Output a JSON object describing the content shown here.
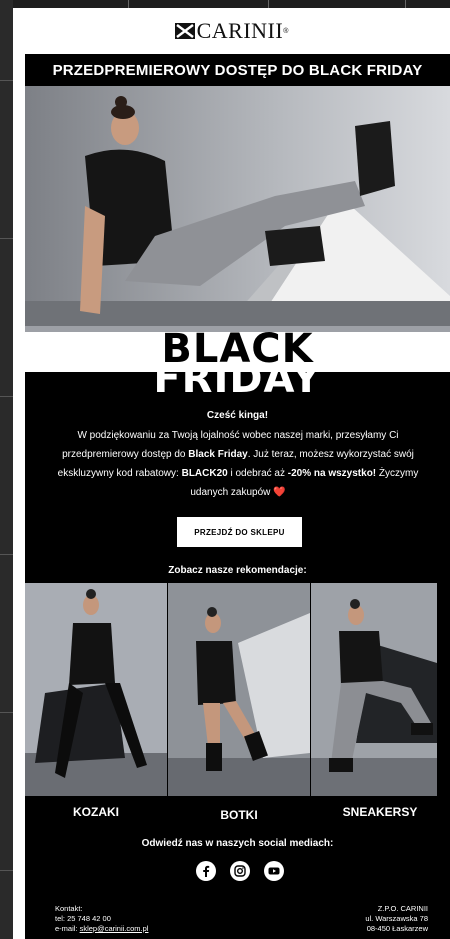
{
  "brand": {
    "name": "CARINII",
    "trademark": "®"
  },
  "promo_banner": "PRZEDPREMIEROWY DOSTĘP DO BLACK FRIDAY",
  "headline": {
    "line1": "BLACK",
    "line2": "FRIDAY"
  },
  "greeting": "Cześć kinga!",
  "message": {
    "part1": "W podziękowaniu za Twoją lojalność wobec naszej marki, przesyłamy Ci przedpremierowy dostęp do ",
    "bold1": "Black Friday",
    "part2": ". Już teraz, możesz wykorzystać swój ekskluzywny kod rabatowy: ",
    "code": "BLACK20",
    "part3": " i odebrać aż ",
    "bold2": "-20% na wszystko!",
    "part4": " Życzymy udanych zakupów ",
    "heart": "❤️"
  },
  "cta_label": "PRZEJDŹ DO SKLEPU",
  "recommendations_title": "Zobacz nasze rekomendacje:",
  "products": [
    {
      "label": "KOZAKI"
    },
    {
      "label": "BOTKI"
    },
    {
      "label": "SNEAKERSY"
    }
  ],
  "social_title": "Odwiedź nas w naszych social mediach:",
  "social_icons": [
    "facebook-icon",
    "instagram-icon",
    "youtube-icon"
  ],
  "footer": {
    "contact_label": "Kontakt:",
    "phone": "tel: 25 748 42 00",
    "email_prefix": "e-mail: ",
    "email": "sklep@carinii.com.pl",
    "company": "Z.P.O. CARINII",
    "street": "ul. Warszawska 78",
    "city": "08-450 Łaskarzew"
  },
  "colors": {
    "background": "#000000",
    "accent_heart": "#e0242b",
    "button_bg": "#ffffff"
  }
}
